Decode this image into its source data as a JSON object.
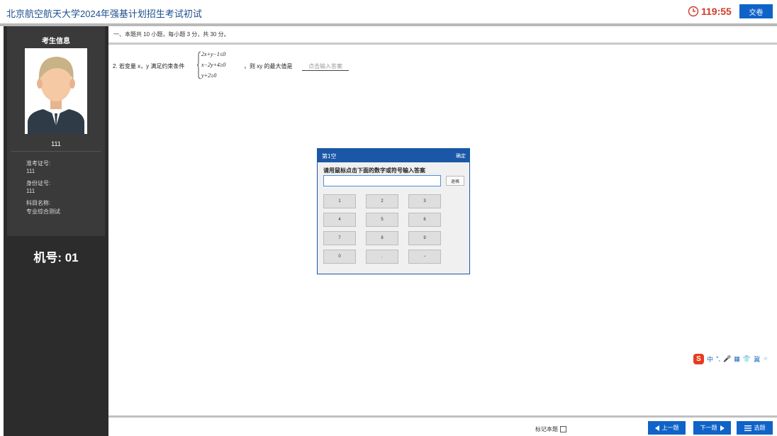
{
  "header": {
    "title": "北京航空航天大学2024年强基计划招生考试初试",
    "timer": "119:55",
    "submit_label": "交卷",
    "timer_color": "#d13a2a",
    "accent": "#0f63c8"
  },
  "sidebar": {
    "panel_title": "考生信息",
    "avatar_name": "111",
    "fields": [
      {
        "label": "准考证号:",
        "value": "111"
      },
      {
        "label": "身份证号:",
        "value": "111"
      },
      {
        "label": "科目名称:",
        "value": "专业综合测试"
      }
    ],
    "machine_no": "机号: 01"
  },
  "section": {
    "text": "一、本题共 10 小题，每小题 3 分，共 30 分。"
  },
  "question": {
    "prefix": "2. 若变量 x，y 满足约束条件",
    "constraints": [
      "2x+y−1≤0",
      "x−2y+4≥0",
      "y+2≥0"
    ],
    "suffix": "，则 xy 的最大值是",
    "answer_placeholder": "点击输入答案"
  },
  "keypad": {
    "title": "第1空",
    "confirm_label": "确定",
    "prompt": "请用鼠标点击下面的数字或符号输入答案",
    "input_value": "",
    "backspace_label": "退格",
    "keys": [
      "1",
      "2",
      "3",
      "4",
      "5",
      "6",
      "7",
      "8",
      "9",
      "0",
      ".",
      "−"
    ]
  },
  "ime": {
    "logo": "S",
    "items": [
      "中",
      "°,",
      "🎤",
      "▦",
      "👕",
      "冀",
      "⁘"
    ]
  },
  "footer": {
    "mark_label": "标记本题",
    "prev_label": "上一题",
    "next_label": "下一题",
    "select_label": "选题"
  }
}
